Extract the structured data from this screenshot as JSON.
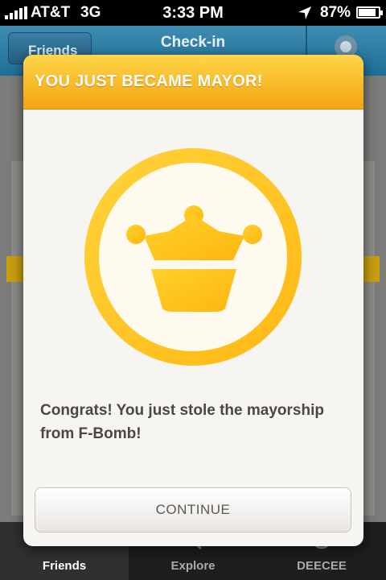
{
  "status_bar": {
    "carrier": "AT&T",
    "network": "3G",
    "time": "3:33 PM",
    "battery": "87%",
    "battery_level": 0.87,
    "icons": [
      "signal-icon",
      "location-arrow-icon",
      "battery-icon"
    ]
  },
  "nav": {
    "back_label": "Friends",
    "title": "Check-in",
    "right_icon": "profile-icon"
  },
  "modal": {
    "title": "YOU JUST BECAME MAYOR!",
    "badge_icon": "mayor-crown-icon",
    "message": "Congrats! You just stole the mayorship from F-Bomb!",
    "continue_label": "CONTINUE"
  },
  "tabs": [
    {
      "label": "Friends",
      "icon": "friends-icon",
      "selected": true
    },
    {
      "label": "Explore",
      "icon": "explore-icon",
      "selected": false
    },
    {
      "label": "DEECEE",
      "icon": "profile-icon",
      "selected": false
    }
  ],
  "colors": {
    "header_top": "#ffd64a",
    "header_bottom": "#f2a411",
    "badge_gold": "#ffc21f",
    "nav_blue": "#2b7aa2"
  }
}
